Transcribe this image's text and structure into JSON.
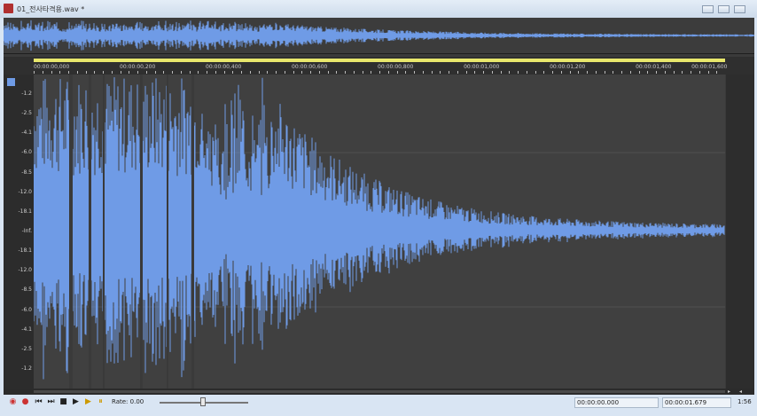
{
  "window": {
    "title": "01_전사타격용.wav *"
  },
  "ruler": {
    "ticks": [
      "00:00:00,000",
      "00:00:00,200",
      "00:00:00,400",
      "00:00:00,600",
      "00:00:00,800",
      "00:00:01,000",
      "00:00:01,200",
      "00:00:01,400",
      "00:00:01,600"
    ]
  },
  "levels": {
    "labels": [
      "-1.2",
      "-2.5",
      "-4.1",
      "-6.0",
      "-8.5",
      "-12.0",
      "-18.1",
      "-Inf.",
      "-18.1",
      "-12.0",
      "-8.5",
      "-6.0",
      "-4.1",
      "-2.5",
      "-1.2"
    ]
  },
  "status": {
    "rate_label": "Rate: 0.00",
    "rate_value": 0.0,
    "cursor_time": "00:00:00.000",
    "length_time": "00:00:01.679",
    "zoom": "1:56"
  },
  "colors": {
    "waveform": "#6f9be6",
    "ruler_marker": "#e8e76c",
    "background": "#404040"
  },
  "icons": [
    "loop-icon",
    "record-icon",
    "go-to-start-icon",
    "go-to-end-icon",
    "stop-icon",
    "play-icon",
    "play-all-icon",
    "pause-icon"
  ]
}
